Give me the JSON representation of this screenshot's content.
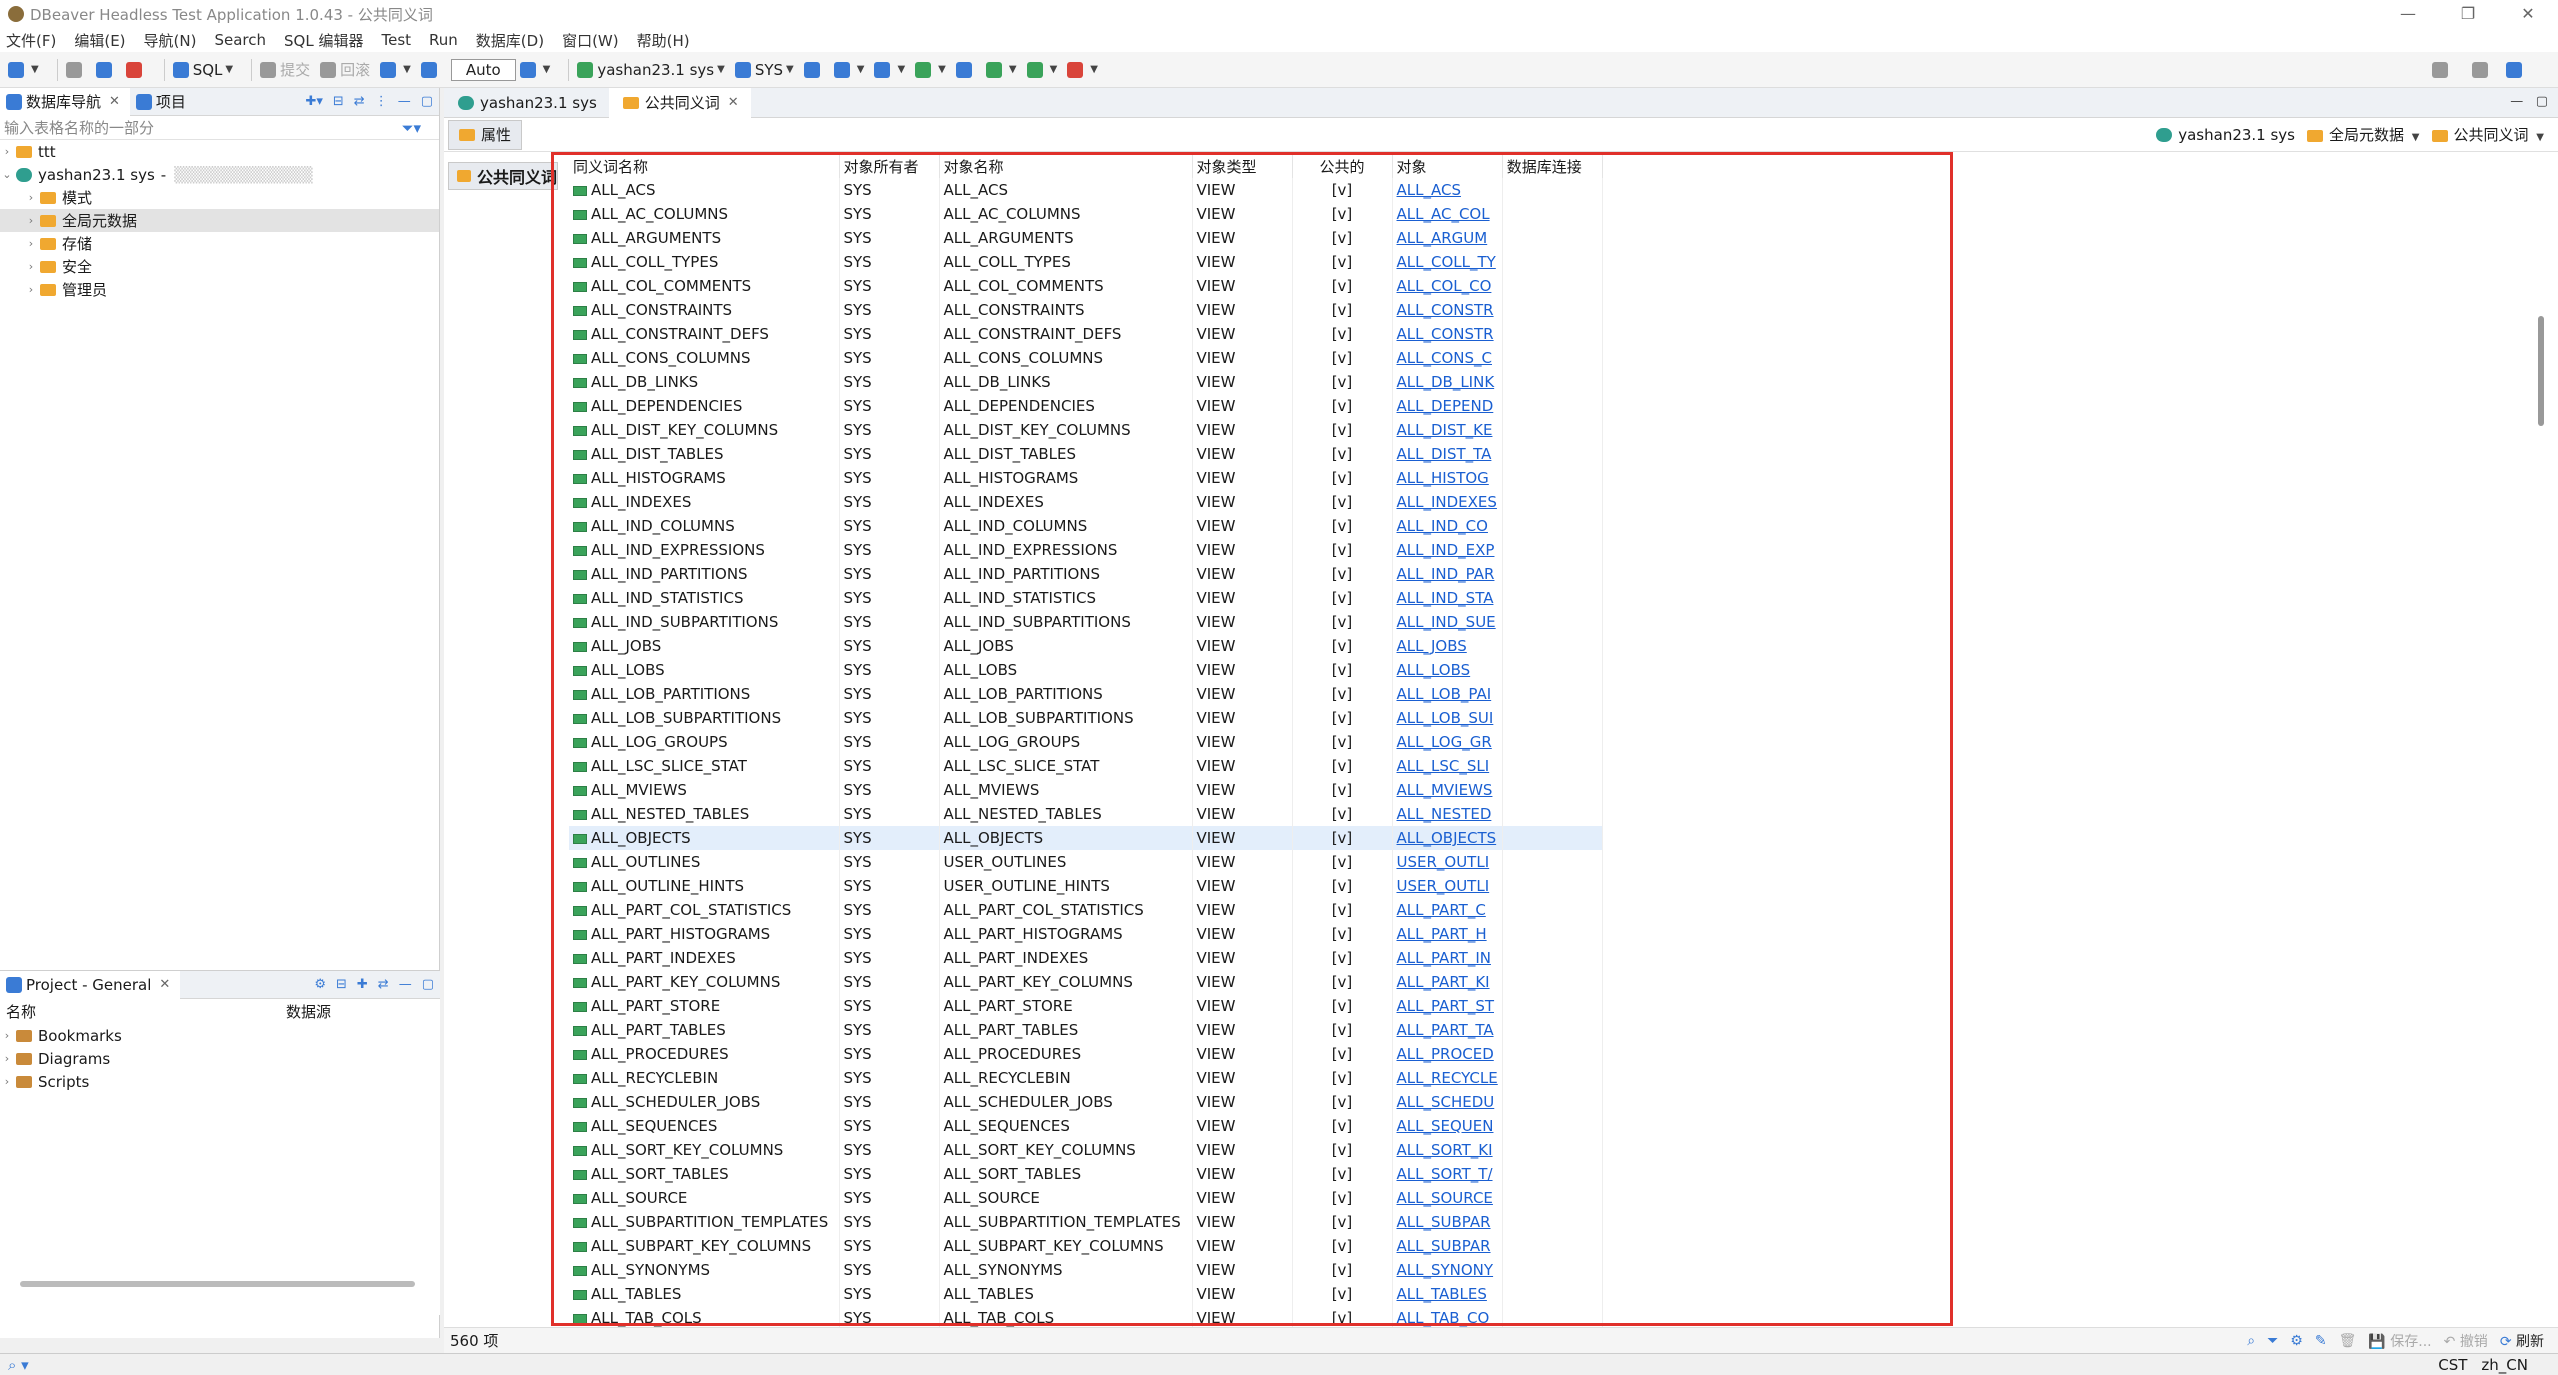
{
  "window": {
    "title": "DBeaver Headless Test Application 1.0.43 - 公共同义词"
  },
  "menu": [
    "文件(F)",
    "编辑(E)",
    "导航(N)",
    "Search",
    "SQL 编辑器",
    "Test",
    "Run",
    "数据库(D)",
    "窗口(W)",
    "帮助(H)"
  ],
  "toolbar": {
    "sql_label": "SQL",
    "commit_label": "提交",
    "rollback_label": "回滚",
    "auto_label": "Auto",
    "connection_label": "yashan23.1 sys",
    "schema_label": "SYS"
  },
  "left_panel": {
    "tab_navigator": "数据库导航",
    "tab_project": "项目",
    "filter_placeholder": "输入表格名称的一部分",
    "tree": [
      {
        "label": "ttt",
        "level": 0,
        "kind": "folder"
      },
      {
        "label": "yashan23.1 sys",
        "level": 0,
        "kind": "db",
        "suffix": "- "
      },
      {
        "label": "模式",
        "level": 1,
        "kind": "folder"
      },
      {
        "label": "全局元数据",
        "level": 1,
        "kind": "folder",
        "selected": true
      },
      {
        "label": "存储",
        "level": 1,
        "kind": "folder"
      },
      {
        "label": "安全",
        "level": 1,
        "kind": "folder"
      },
      {
        "label": "管理员",
        "level": 1,
        "kind": "folder"
      }
    ]
  },
  "project_panel": {
    "title": "Project - General",
    "col_name": "名称",
    "col_source": "数据源",
    "items": [
      "Bookmarks",
      "Diagrams",
      "Scripts"
    ]
  },
  "editor": {
    "tabs": [
      "yashan23.1 sys",
      "公共同义词"
    ],
    "subtab": "属性",
    "side_title": "公共同义词",
    "breadcrumbs": [
      "yashan23.1 sys",
      "全局元数据",
      "公共同义词"
    ],
    "count_label": "560 项"
  },
  "grid": {
    "columns": [
      "同义词名称",
      "对象所有者",
      "对象名称",
      "对象类型",
      "公共的",
      "对象",
      "数据库连接"
    ],
    "rows": [
      [
        "ALL_ACS",
        "SYS",
        "ALL_ACS",
        "VIEW",
        "[v]",
        "ALL_ACS"
      ],
      [
        "ALL_AC_COLUMNS",
        "SYS",
        "ALL_AC_COLUMNS",
        "VIEW",
        "[v]",
        "ALL_AC_COL"
      ],
      [
        "ALL_ARGUMENTS",
        "SYS",
        "ALL_ARGUMENTS",
        "VIEW",
        "[v]",
        "ALL_ARGUM"
      ],
      [
        "ALL_COLL_TYPES",
        "SYS",
        "ALL_COLL_TYPES",
        "VIEW",
        "[v]",
        "ALL_COLL_TY"
      ],
      [
        "ALL_COL_COMMENTS",
        "SYS",
        "ALL_COL_COMMENTS",
        "VIEW",
        "[v]",
        "ALL_COL_CO"
      ],
      [
        "ALL_CONSTRAINTS",
        "SYS",
        "ALL_CONSTRAINTS",
        "VIEW",
        "[v]",
        "ALL_CONSTR"
      ],
      [
        "ALL_CONSTRAINT_DEFS",
        "SYS",
        "ALL_CONSTRAINT_DEFS",
        "VIEW",
        "[v]",
        "ALL_CONSTR"
      ],
      [
        "ALL_CONS_COLUMNS",
        "SYS",
        "ALL_CONS_COLUMNS",
        "VIEW",
        "[v]",
        "ALL_CONS_C"
      ],
      [
        "ALL_DB_LINKS",
        "SYS",
        "ALL_DB_LINKS",
        "VIEW",
        "[v]",
        "ALL_DB_LINK"
      ],
      [
        "ALL_DEPENDENCIES",
        "SYS",
        "ALL_DEPENDENCIES",
        "VIEW",
        "[v]",
        "ALL_DEPEND"
      ],
      [
        "ALL_DIST_KEY_COLUMNS",
        "SYS",
        "ALL_DIST_KEY_COLUMNS",
        "VIEW",
        "[v]",
        "ALL_DIST_KE"
      ],
      [
        "ALL_DIST_TABLES",
        "SYS",
        "ALL_DIST_TABLES",
        "VIEW",
        "[v]",
        "ALL_DIST_TA"
      ],
      [
        "ALL_HISTOGRAMS",
        "SYS",
        "ALL_HISTOGRAMS",
        "VIEW",
        "[v]",
        "ALL_HISTOG"
      ],
      [
        "ALL_INDEXES",
        "SYS",
        "ALL_INDEXES",
        "VIEW",
        "[v]",
        "ALL_INDEXES"
      ],
      [
        "ALL_IND_COLUMNS",
        "SYS",
        "ALL_IND_COLUMNS",
        "VIEW",
        "[v]",
        "ALL_IND_CO"
      ],
      [
        "ALL_IND_EXPRESSIONS",
        "SYS",
        "ALL_IND_EXPRESSIONS",
        "VIEW",
        "[v]",
        "ALL_IND_EXP"
      ],
      [
        "ALL_IND_PARTITIONS",
        "SYS",
        "ALL_IND_PARTITIONS",
        "VIEW",
        "[v]",
        "ALL_IND_PAR"
      ],
      [
        "ALL_IND_STATISTICS",
        "SYS",
        "ALL_IND_STATISTICS",
        "VIEW",
        "[v]",
        "ALL_IND_STA"
      ],
      [
        "ALL_IND_SUBPARTITIONS",
        "SYS",
        "ALL_IND_SUBPARTITIONS",
        "VIEW",
        "[v]",
        "ALL_IND_SUE"
      ],
      [
        "ALL_JOBS",
        "SYS",
        "ALL_JOBS",
        "VIEW",
        "[v]",
        "ALL_JOBS"
      ],
      [
        "ALL_LOBS",
        "SYS",
        "ALL_LOBS",
        "VIEW",
        "[v]",
        "ALL_LOBS"
      ],
      [
        "ALL_LOB_PARTITIONS",
        "SYS",
        "ALL_LOB_PARTITIONS",
        "VIEW",
        "[v]",
        "ALL_LOB_PAI"
      ],
      [
        "ALL_LOB_SUBPARTITIONS",
        "SYS",
        "ALL_LOB_SUBPARTITIONS",
        "VIEW",
        "[v]",
        "ALL_LOB_SUI"
      ],
      [
        "ALL_LOG_GROUPS",
        "SYS",
        "ALL_LOG_GROUPS",
        "VIEW",
        "[v]",
        "ALL_LOG_GR"
      ],
      [
        "ALL_LSC_SLICE_STAT",
        "SYS",
        "ALL_LSC_SLICE_STAT",
        "VIEW",
        "[v]",
        "ALL_LSC_SLI"
      ],
      [
        "ALL_MVIEWS",
        "SYS",
        "ALL_MVIEWS",
        "VIEW",
        "[v]",
        "ALL_MVIEWS"
      ],
      [
        "ALL_NESTED_TABLES",
        "SYS",
        "ALL_NESTED_TABLES",
        "VIEW",
        "[v]",
        "ALL_NESTED"
      ],
      [
        "ALL_OBJECTS",
        "SYS",
        "ALL_OBJECTS",
        "VIEW",
        "[v]",
        "ALL_OBJECTS"
      ],
      [
        "ALL_OUTLINES",
        "SYS",
        "USER_OUTLINES",
        "VIEW",
        "[v]",
        "USER_OUTLI"
      ],
      [
        "ALL_OUTLINE_HINTS",
        "SYS",
        "USER_OUTLINE_HINTS",
        "VIEW",
        "[v]",
        "USER_OUTLI"
      ],
      [
        "ALL_PART_COL_STATISTICS",
        "SYS",
        "ALL_PART_COL_STATISTICS",
        "VIEW",
        "[v]",
        "ALL_PART_C"
      ],
      [
        "ALL_PART_HISTOGRAMS",
        "SYS",
        "ALL_PART_HISTOGRAMS",
        "VIEW",
        "[v]",
        "ALL_PART_H"
      ],
      [
        "ALL_PART_INDEXES",
        "SYS",
        "ALL_PART_INDEXES",
        "VIEW",
        "[v]",
        "ALL_PART_IN"
      ],
      [
        "ALL_PART_KEY_COLUMNS",
        "SYS",
        "ALL_PART_KEY_COLUMNS",
        "VIEW",
        "[v]",
        "ALL_PART_KI"
      ],
      [
        "ALL_PART_STORE",
        "SYS",
        "ALL_PART_STORE",
        "VIEW",
        "[v]",
        "ALL_PART_ST"
      ],
      [
        "ALL_PART_TABLES",
        "SYS",
        "ALL_PART_TABLES",
        "VIEW",
        "[v]",
        "ALL_PART_TA"
      ],
      [
        "ALL_PROCEDURES",
        "SYS",
        "ALL_PROCEDURES",
        "VIEW",
        "[v]",
        "ALL_PROCED"
      ],
      [
        "ALL_RECYCLEBIN",
        "SYS",
        "ALL_RECYCLEBIN",
        "VIEW",
        "[v]",
        "ALL_RECYCLE"
      ],
      [
        "ALL_SCHEDULER_JOBS",
        "SYS",
        "ALL_SCHEDULER_JOBS",
        "VIEW",
        "[v]",
        "ALL_SCHEDU"
      ],
      [
        "ALL_SEQUENCES",
        "SYS",
        "ALL_SEQUENCES",
        "VIEW",
        "[v]",
        "ALL_SEQUEN"
      ],
      [
        "ALL_SORT_KEY_COLUMNS",
        "SYS",
        "ALL_SORT_KEY_COLUMNS",
        "VIEW",
        "[v]",
        "ALL_SORT_KI"
      ],
      [
        "ALL_SORT_TABLES",
        "SYS",
        "ALL_SORT_TABLES",
        "VIEW",
        "[v]",
        "ALL_SORT_T/"
      ],
      [
        "ALL_SOURCE",
        "SYS",
        "ALL_SOURCE",
        "VIEW",
        "[v]",
        "ALL_SOURCE"
      ],
      [
        "ALL_SUBPARTITION_TEMPLATES",
        "SYS",
        "ALL_SUBPARTITION_TEMPLATES",
        "VIEW",
        "[v]",
        "ALL_SUBPAR"
      ],
      [
        "ALL_SUBPART_KEY_COLUMNS",
        "SYS",
        "ALL_SUBPART_KEY_COLUMNS",
        "VIEW",
        "[v]",
        "ALL_SUBPAR"
      ],
      [
        "ALL_SYNONYMS",
        "SYS",
        "ALL_SYNONYMS",
        "VIEW",
        "[v]",
        "ALL_SYNONY"
      ],
      [
        "ALL_TABLES",
        "SYS",
        "ALL_TABLES",
        "VIEW",
        "[v]",
        "ALL_TABLES"
      ],
      [
        "ALL_TAB_COLS",
        "SYS",
        "ALL_TAB_COLS",
        "VIEW",
        "[v]",
        "ALL_TAB_CO"
      ]
    ],
    "highlighted_row": 27
  },
  "bottom_actions": {
    "save": "保存...",
    "cancel": "撤销",
    "refresh": "刷新"
  },
  "status": {
    "timezone": "CST",
    "locale": "zh_CN"
  },
  "colors": {
    "highlight_box": "#e0302a",
    "link": "#1a5fd1",
    "selected_row": "#e3eefb"
  }
}
